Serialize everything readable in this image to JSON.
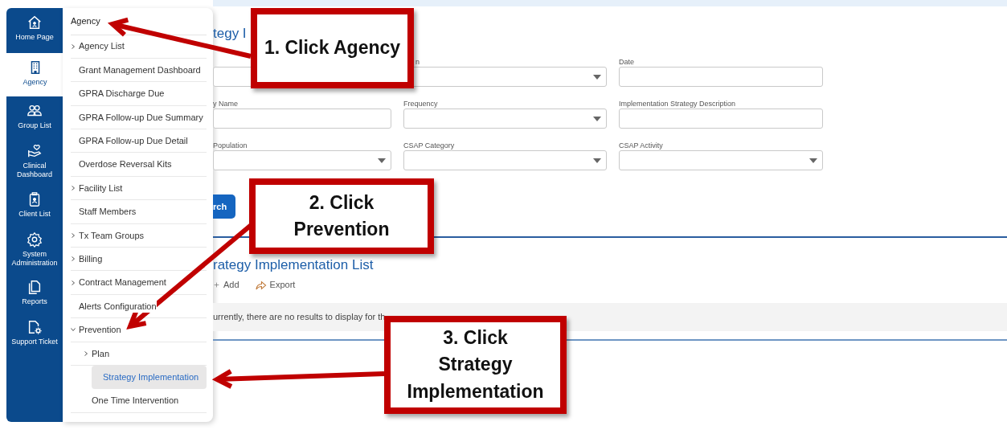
{
  "sidebar": {
    "items": [
      {
        "label": "Home Page",
        "selected": false
      },
      {
        "label": "Agency",
        "selected": true
      },
      {
        "label": "Group List",
        "selected": false
      },
      {
        "label": "Clinical Dashboard",
        "selected": false
      },
      {
        "label": "Client List",
        "selected": false
      },
      {
        "label": "System Administration",
        "selected": false
      },
      {
        "label": "Reports",
        "selected": false
      },
      {
        "label": "Support Ticket",
        "selected": false
      }
    ]
  },
  "menu": {
    "header": "Agency",
    "items": [
      {
        "label": "Agency List",
        "expandable": true,
        "expanded": false,
        "selected": false
      },
      {
        "label": "Grant Management Dashboard",
        "expandable": false,
        "selected": false
      },
      {
        "label": "GPRA Discharge Due",
        "expandable": false,
        "selected": false
      },
      {
        "label": "GPRA Follow-up Due Summary",
        "expandable": false,
        "selected": false
      },
      {
        "label": "GPRA Follow-up Due Detail",
        "expandable": false,
        "selected": false
      },
      {
        "label": "Overdose Reversal Kits",
        "expandable": false,
        "selected": false
      },
      {
        "label": "Facility List",
        "expandable": true,
        "expanded": false,
        "selected": false
      },
      {
        "label": "Staff Members",
        "expandable": false,
        "selected": false
      },
      {
        "label": "Tx Team Groups",
        "expandable": true,
        "expanded": false,
        "selected": false
      },
      {
        "label": "Billing",
        "expandable": true,
        "expanded": false,
        "selected": false
      },
      {
        "label": "Contract Management",
        "expandable": true,
        "expanded": false,
        "selected": false
      },
      {
        "label": "Alerts Configuration",
        "expandable": false,
        "selected": false
      },
      {
        "label": "Prevention",
        "expandable": true,
        "expanded": true,
        "selected": false,
        "children": [
          {
            "label": "Plan",
            "expandable": true,
            "expanded": false,
            "selected": false
          },
          {
            "label": "Strategy Implementation",
            "expandable": false,
            "selected": true
          },
          {
            "label": "One Time Intervention",
            "expandable": false,
            "selected": false
          }
        ]
      }
    ]
  },
  "page": {
    "title": "tegy I",
    "form": {
      "fields": [
        {
          "kind": "text"
        },
        {
          "label": "n",
          "kind": "select"
        },
        {
          "label": "Date",
          "kind": "text"
        },
        {
          "label": "y Name",
          "kind": "text"
        },
        {
          "label": "Frequency",
          "kind": "select"
        },
        {
          "label": "Implementation Strategy Description",
          "kind": "text"
        },
        {
          "label": "Population",
          "kind": "select"
        },
        {
          "label": "CSAP Category",
          "kind": "select"
        },
        {
          "label": "CSAP Activity",
          "kind": "select"
        }
      ],
      "search_button": "rch"
    },
    "list": {
      "title": "rategy Implementation List",
      "actions": [
        {
          "label": "Add"
        },
        {
          "label": "Export"
        }
      ],
      "empty_message": "urrently, there are no results to display for th"
    }
  },
  "annotations": [
    {
      "text": "1. Click Agency",
      "kind": "agency"
    },
    {
      "text": "2. Click\nPrevention",
      "kind": "prevention"
    },
    {
      "text": "3. Click\nStrategy\nImplementation",
      "kind": "strategy"
    }
  ]
}
